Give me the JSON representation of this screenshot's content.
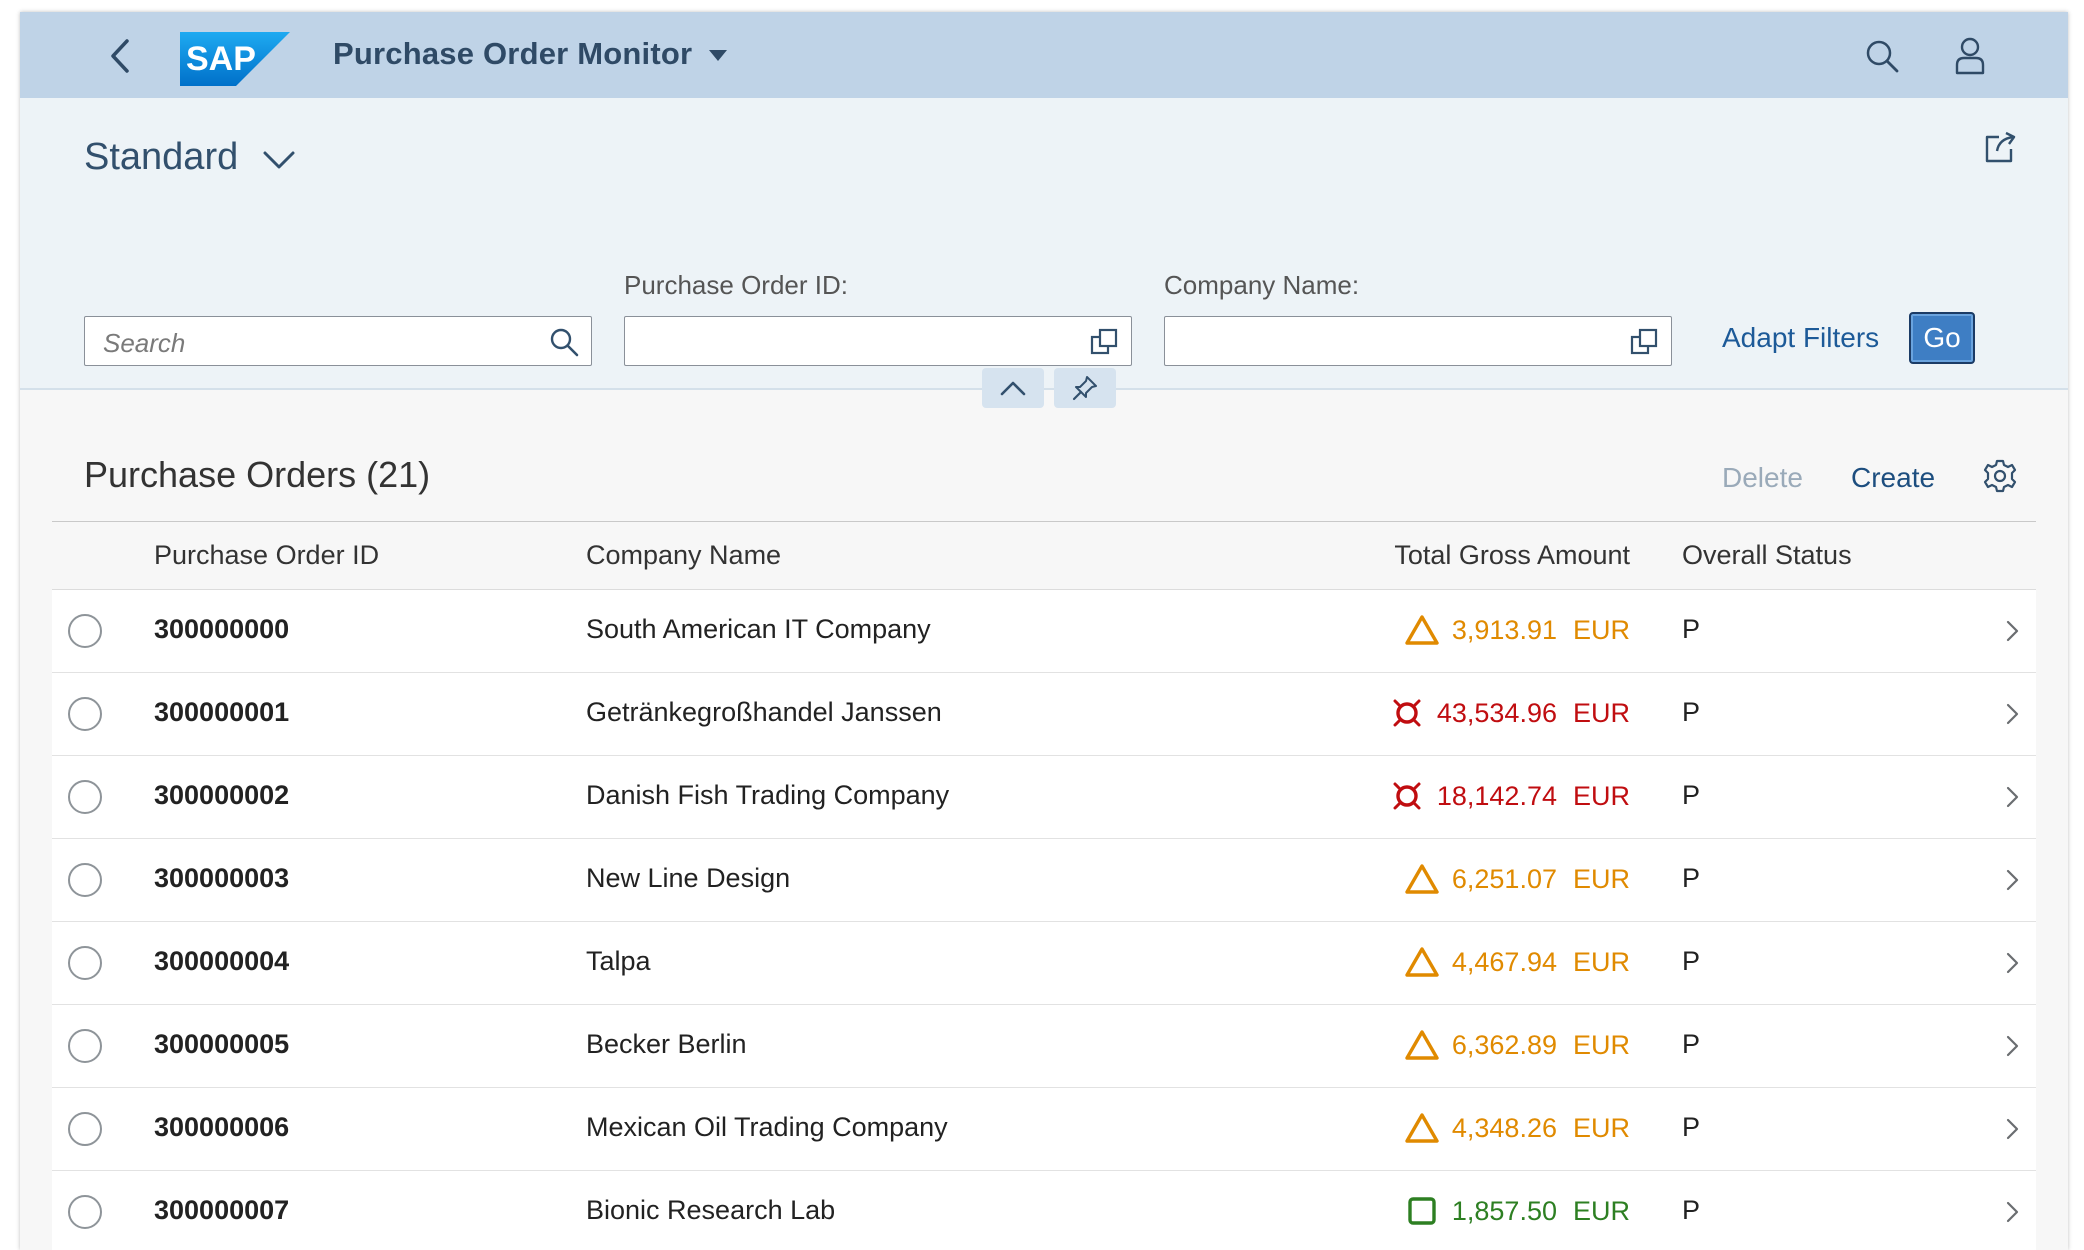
{
  "shell": {
    "logo_text": "SAP",
    "app_title": "Purchase Order Monitor"
  },
  "header": {
    "variant": "Standard",
    "search_placeholder": "Search",
    "filters": [
      {
        "label": "Purchase Order ID:",
        "value": ""
      },
      {
        "label": "Company Name:",
        "value": ""
      }
    ],
    "adapt_filters": "Adapt Filters",
    "go": "Go"
  },
  "table": {
    "title": "Purchase Orders (21)",
    "delete_label": "Delete",
    "create_label": "Create",
    "columns": [
      "Purchase Order ID",
      "Company Name",
      "Total Gross Amount",
      "Overall Status"
    ],
    "rows": [
      {
        "id": "300000000",
        "company": "South American IT Company",
        "amount": "3,913.91",
        "currency": "EUR",
        "status": "P",
        "criticality": "warning"
      },
      {
        "id": "300000001",
        "company": "Getränkegroßhandel Janssen",
        "amount": "43,534.96",
        "currency": "EUR",
        "status": "P",
        "criticality": "error"
      },
      {
        "id": "300000002",
        "company": "Danish Fish Trading Company",
        "amount": "18,142.74",
        "currency": "EUR",
        "status": "P",
        "criticality": "error"
      },
      {
        "id": "300000003",
        "company": "New Line Design",
        "amount": "6,251.07",
        "currency": "EUR",
        "status": "P",
        "criticality": "warning"
      },
      {
        "id": "300000004",
        "company": "Talpa",
        "amount": "4,467.94",
        "currency": "EUR",
        "status": "P",
        "criticality": "warning"
      },
      {
        "id": "300000005",
        "company": "Becker Berlin",
        "amount": "6,362.89",
        "currency": "EUR",
        "status": "P",
        "criticality": "warning"
      },
      {
        "id": "300000006",
        "company": "Mexican Oil Trading Company",
        "amount": "4,348.26",
        "currency": "EUR",
        "status": "P",
        "criticality": "warning"
      },
      {
        "id": "300000007",
        "company": "Bionic Research Lab",
        "amount": "1,857.50",
        "currency": "EUR",
        "status": "P",
        "criticality": "success"
      }
    ]
  },
  "colors": {
    "shell_bg": "#bfd3e7",
    "warning": "#e08a00",
    "error": "#c00d10",
    "success": "#2d7f22",
    "accent": "#3e7ec4"
  },
  "icons": {
    "warning": "warning-triangle-icon",
    "error": "error-circle-icon",
    "success": "success-square-icon"
  }
}
